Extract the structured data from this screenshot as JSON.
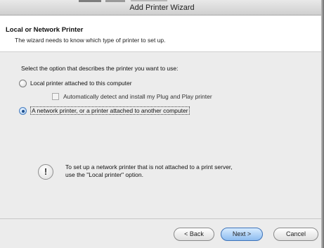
{
  "window": {
    "title": "Add Printer Wizard"
  },
  "header": {
    "title": "Local or Network Printer",
    "subtitle": "The wizard needs to know which type of printer to set up."
  },
  "body": {
    "prompt": "Select the option that describes the printer you want to use:",
    "options": [
      {
        "label": "Local printer attached to this computer",
        "selected": false
      },
      {
        "label": "A network printer, or a printer attached to another computer",
        "selected": true
      }
    ],
    "sub_option": {
      "label": "Automatically detect and install my Plug and Play printer",
      "checked": false
    },
    "info_icon": "exclamation-icon",
    "info_text": [
      "To set up a network printer that is not attached to a print server,",
      "use the \"Local printer\" option."
    ]
  },
  "footer": {
    "back_label": "< Back",
    "next_label": "Next >",
    "cancel_label": "Cancel"
  },
  "colors": {
    "accent": "#4a7fc0",
    "next_button": "#8dbcf0"
  }
}
